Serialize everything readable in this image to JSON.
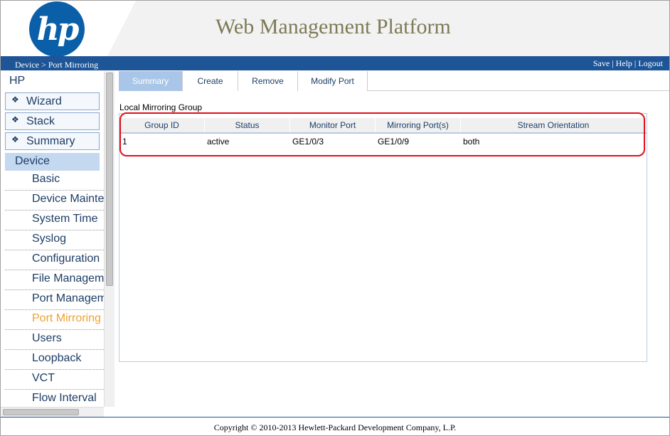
{
  "header": {
    "logo_text": "hp",
    "title": "Web Management Platform"
  },
  "bluebar": {
    "breadcrumb": "Device > Port Mirroring",
    "links": [
      "Save",
      "Help",
      "Logout"
    ],
    "separator": " | "
  },
  "sidebar": {
    "root": "HP",
    "sections": [
      {
        "label": "Wizard"
      },
      {
        "label": "Stack"
      },
      {
        "label": "Summary"
      }
    ],
    "active_section": "Device",
    "sub_items": [
      {
        "label": "Basic"
      },
      {
        "label": "Device Maintenance"
      },
      {
        "label": "System Time"
      },
      {
        "label": "Syslog"
      },
      {
        "label": "Configuration"
      },
      {
        "label": "File Management"
      },
      {
        "label": "Port Management"
      },
      {
        "label": "Port Mirroring"
      },
      {
        "label": "Users"
      },
      {
        "label": "Loopback"
      },
      {
        "label": "VCT"
      },
      {
        "label": "Flow Interval"
      }
    ]
  },
  "tabs": [
    {
      "label": "Summary"
    },
    {
      "label": "Create"
    },
    {
      "label": "Remove"
    },
    {
      "label": "Modify Port"
    }
  ],
  "main": {
    "group_label": "Local Mirroring Group",
    "columns": [
      "Group ID",
      "Status",
      "Monitor Port",
      "Mirroring Port(s)",
      "Stream Orientation"
    ],
    "rows": [
      [
        "1",
        "active",
        "GE1/0/3",
        "GE1/0/9",
        "both"
      ]
    ]
  },
  "footer": {
    "copyright": "Copyright © 2010-2013 Hewlett-Packard Development Company, L.P."
  },
  "colors": {
    "brand_blue": "#1d5597",
    "logo_blue": "#0b5fa9",
    "title_olive": "#7d7a56",
    "active_tab": "#a9c6e8",
    "selected_item": "#f0a030",
    "highlight_red": "#e0101a"
  },
  "icons": {
    "section_marker": "diamond-icon"
  }
}
